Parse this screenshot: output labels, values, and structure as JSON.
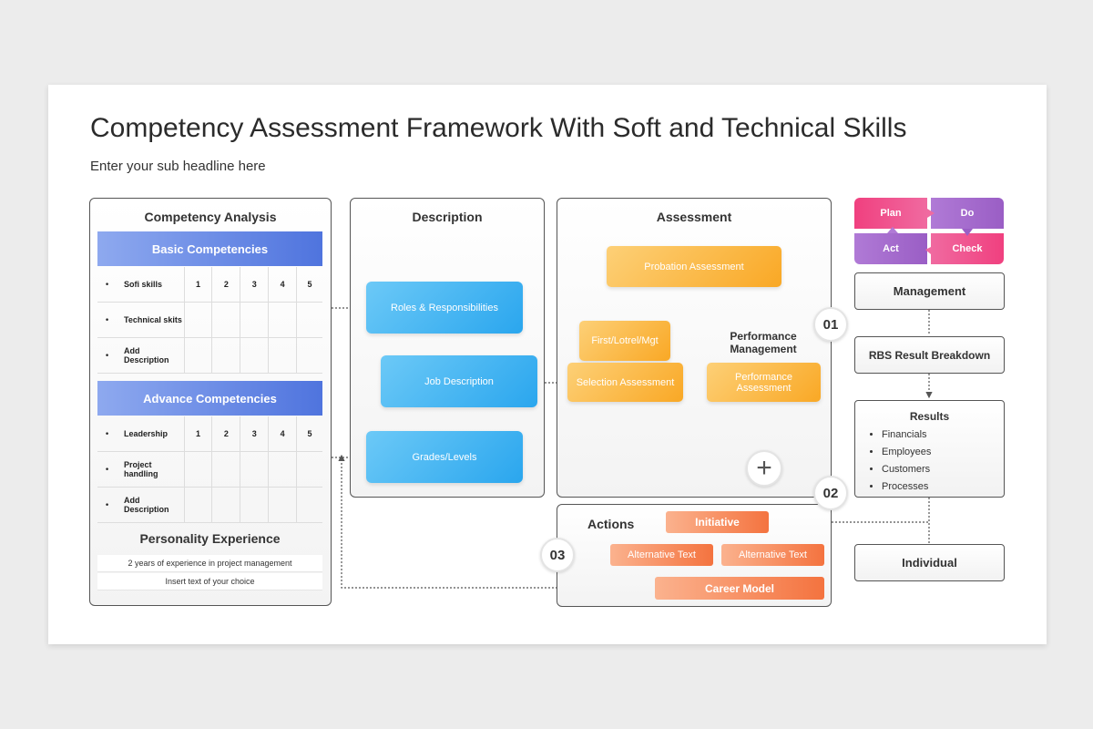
{
  "title": "Competency Assessment Framework With Soft and Technical Skills",
  "subtitle": "Enter your sub headline here",
  "competency": {
    "title": "Competency Analysis",
    "basic_header": "Basic Competencies",
    "scale": [
      "1",
      "2",
      "3",
      "4",
      "5"
    ],
    "basic_rows": [
      "Sofi skills",
      "Technical skits",
      "Add Description"
    ],
    "advance_header": "Advance Competencies",
    "advance_rows": [
      "Leadership",
      "Project handling",
      "Add Description"
    ],
    "personality_title": "Personality Experience",
    "personality_lines": [
      "2 years of experience in project management",
      "Insert text of your choice"
    ]
  },
  "description": {
    "title": "Description",
    "roles": "Roles & Responsibilities",
    "job": "Job Description",
    "grades": "Grades/Levels"
  },
  "assessment": {
    "title": "Assessment",
    "probation": "Probation Assessment",
    "first": "First/Lotrel/Mgt",
    "selection": "Selection Assessment",
    "perf_label": "Performance Management",
    "perf_box": "Performance Assessment"
  },
  "actions": {
    "title": "Actions",
    "initiative": "Initiative",
    "alt1": "Alternative Text",
    "alt2": "Alternative Text",
    "career": "Career Model"
  },
  "numbers": {
    "n01": "01",
    "n02": "02",
    "n03": "03"
  },
  "pdca": {
    "plan": "Plan",
    "do": "Do",
    "act": "Act",
    "check": "Check"
  },
  "right": {
    "management": "Management",
    "rbs": "RBS Result Breakdown",
    "results_title": "Results",
    "results_items": [
      "Financials",
      "Employees",
      "Customers",
      "Processes"
    ],
    "individual": "Individual"
  },
  "colors": {
    "blue_bar": "#4f74de",
    "blue_btn": "#2aa6ee",
    "orange": "#f9a825",
    "coral": "#f4733f",
    "pink": "#f0407f",
    "purple": "#a061c8"
  }
}
